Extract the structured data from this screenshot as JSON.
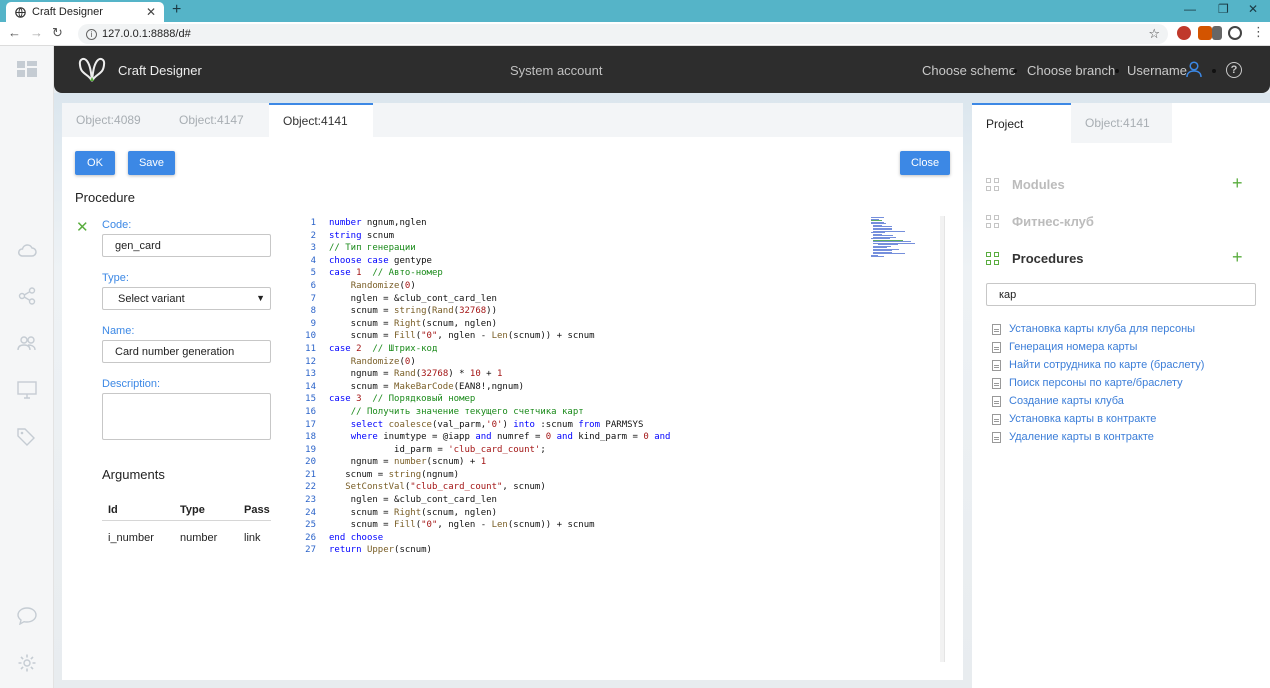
{
  "browser": {
    "tab_title": "Craft Designer",
    "url": "127.0.0.1:8888/d#",
    "new_tab_label": "+",
    "close_tab_label": "✕"
  },
  "header": {
    "brand": "Craft Designer",
    "system_account": "System account",
    "choose_scheme": "Choose scheme",
    "choose_branch": "Choose branch",
    "username": "Username",
    "help": "?"
  },
  "tabs": [
    "Object:4089",
    "Object:4147",
    "Object:4141"
  ],
  "toolbar": {
    "ok": "OK",
    "save": "Save",
    "close": "Close"
  },
  "form": {
    "title": "Procedure",
    "code_label": "Code:",
    "code_value": "gen_card",
    "type_label": "Type:",
    "type_value": "Select variant",
    "name_label": "Name:",
    "name_value": "Card number generation",
    "description_label": "Description:",
    "description_value": ""
  },
  "arguments": {
    "title": "Arguments",
    "columns": [
      "Id",
      "Type",
      "Pass"
    ],
    "rows": [
      {
        "id": "i_number",
        "type": "number",
        "pass": "link"
      }
    ]
  },
  "code_lines": [
    "number ngnum,nglen",
    "string scnum",
    "// Тип генерации",
    "choose case gentype",
    "case 1  // Авто-номер",
    "    Randomize(0)",
    "    nglen = &club_cont_card_len",
    "    scnum = string(Rand(32768))",
    "    scnum = Right(scnum, nglen)",
    "    scnum = Fill(\"0\", nglen - Len(scnum)) + scnum",
    "case 2  // Штрих-код",
    "    Randomize(0)",
    "    ngnum = Rand(32768) * 10 + 1",
    "    scnum = MakeBarCode(EAN8!,ngnum)",
    "case 3  // Порядковый номер",
    "    // Получить значение текущего счетчика карт",
    "    select coalesce(val_parm,'0') into :scnum from PARMSYS",
    "    where inumtype = @iapp and numref = 0 and kind_parm = 0 and",
    "            id_parm = 'club_card_count';",
    "    ngnum = number(scnum) + 1",
    "   scnum = string(ngnum)",
    "   SetConstVal(\"club_card_count\", scnum)",
    "    nglen = &club_cont_card_len",
    "    scnum = Right(scnum, nglen)",
    "    scnum = Fill(\"0\", nglen - Len(scnum)) + scnum",
    "end choose",
    "return Upper(scnum)"
  ],
  "right_panel": {
    "tabs": [
      "Project",
      "Object:4141"
    ],
    "sections": [
      {
        "label": "Modules",
        "has_add": true
      },
      {
        "label": "Фитнес-клуб",
        "has_add": false
      },
      {
        "label": "Procedures",
        "has_add": true
      }
    ],
    "add_label": "+",
    "search_value": "кар",
    "results": [
      "Установка карты клуба для персоны",
      "Генерация номера карты",
      "Найти сотрудника по карте (браслету)",
      "Поиск персоны по карте/браслету",
      "Создание карты клуба",
      "Установка карты в контракте",
      "Удаление карты в контракте"
    ]
  },
  "colors": {
    "accent": "#3c88e5",
    "green": "#5aad3f",
    "header_bg": "#2d2d2d",
    "browser_bar": "#55b4c8"
  }
}
